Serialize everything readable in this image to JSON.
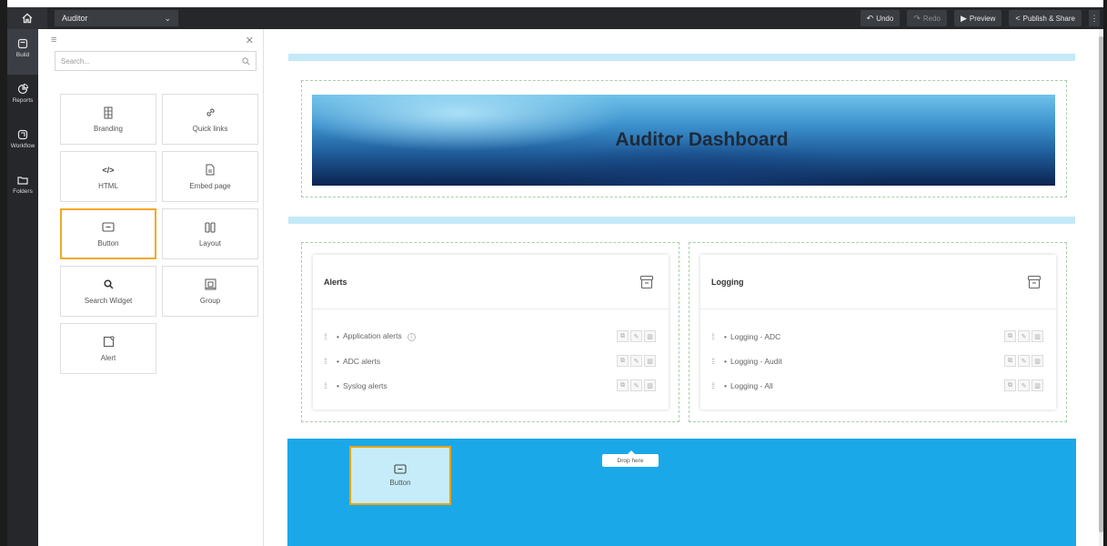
{
  "topbar": {
    "app_name": "Auditor",
    "actions": {
      "undo": "Undo",
      "redo": "Redo",
      "preview": "Preview",
      "publish": "Publish & Share"
    }
  },
  "leftnav": {
    "items": [
      {
        "label": "Build",
        "icon": "build-icon"
      },
      {
        "label": "Reports",
        "icon": "reports-icon"
      },
      {
        "label": "Workflow",
        "icon": "workflow-icon"
      },
      {
        "label": "Folders",
        "icon": "folders-icon"
      }
    ]
  },
  "panel": {
    "search_placeholder": "Search...",
    "widgets": [
      {
        "label": "Branding",
        "icon": "branding-icon"
      },
      {
        "label": "Quick links",
        "icon": "link-icon"
      },
      {
        "label": "HTML",
        "icon": "code-icon"
      },
      {
        "label": "Embed page",
        "icon": "document-icon"
      },
      {
        "label": "Button",
        "icon": "button-icon",
        "selected": true
      },
      {
        "label": "Layout",
        "icon": "columns-icon"
      },
      {
        "label": "Search Widget",
        "icon": "search-icon"
      },
      {
        "label": "Group",
        "icon": "group-icon"
      },
      {
        "label": "Alert",
        "icon": "alert-icon"
      }
    ]
  },
  "canvas": {
    "banner_title": "Auditor Dashboard",
    "cards": [
      {
        "title": "Alerts",
        "items": [
          "Application alerts",
          "ADC alerts",
          "Syslog alerts"
        ]
      },
      {
        "title": "Logging",
        "items": [
          "Logging - ADC",
          "Logging - Audit",
          "Logging - All"
        ]
      }
    ],
    "drop_hint": "Drop here",
    "dragged_widget_label": "Button"
  },
  "colors": {
    "accent_highlight": "#f3a823",
    "drop_zone": "#1ba8e8",
    "divider": "#c4e9f8",
    "dark_chrome": "#25272b"
  }
}
